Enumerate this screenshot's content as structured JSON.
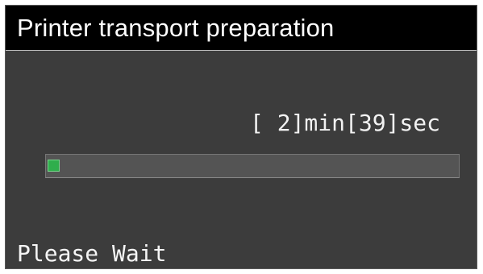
{
  "header": {
    "title": "Printer transport preparation"
  },
  "countdown": {
    "text": "[ 2]min[39]sec"
  },
  "progress": {
    "fraction": 0.03,
    "fill_color": "#2fae4c"
  },
  "status": {
    "message": "Please Wait"
  },
  "colors": {
    "title_background": "#000000",
    "screen_background": "#3c3c3c",
    "text": "#ffffff"
  }
}
